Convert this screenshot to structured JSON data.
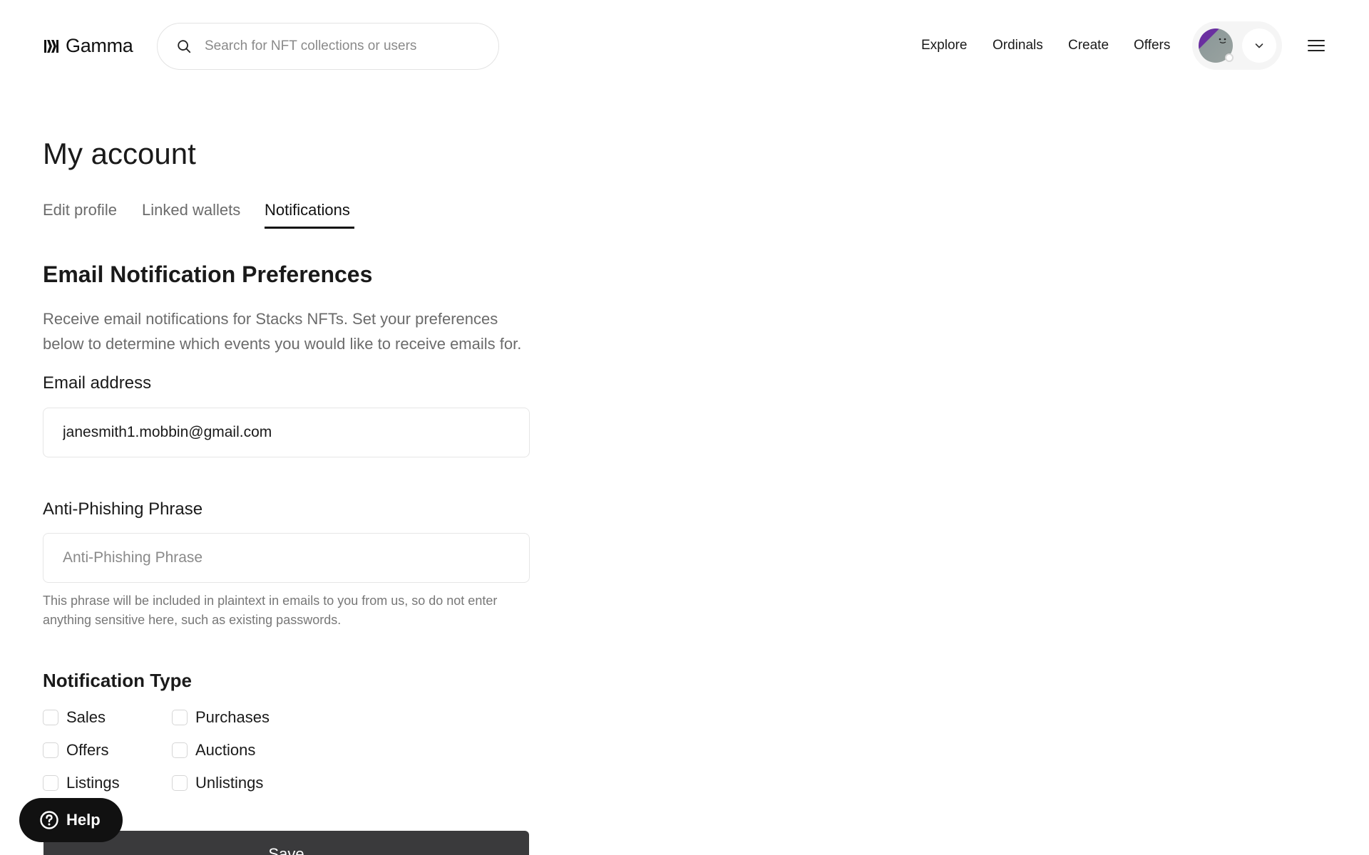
{
  "header": {
    "brand": "Gamma",
    "search": {
      "placeholder": "Search for NFT collections or users"
    },
    "nav": [
      {
        "label": "Explore"
      },
      {
        "label": "Ordinals"
      },
      {
        "label": "Create"
      },
      {
        "label": "Offers"
      }
    ],
    "icons": {
      "logo": "gamma-logo-icon",
      "search": "search-icon",
      "account_menu": "chevron-down-icon",
      "main_menu": "hamburger-menu-icon"
    }
  },
  "page": {
    "title": "My account",
    "tabs": [
      {
        "label": "Edit profile",
        "active": false
      },
      {
        "label": "Linked wallets",
        "active": false
      },
      {
        "label": "Notifications",
        "active": true
      }
    ]
  },
  "notifications": {
    "section_title": "Email Notification Preferences",
    "description": "Receive email notifications for Stacks NFTs. Set your preferences below to determine which events you would like to receive emails for.",
    "email": {
      "label": "Email address",
      "value": "janesmith1.mobbin@gmail.com"
    },
    "anti_phishing": {
      "label": "Anti-Phishing Phrase",
      "placeholder": "Anti-Phishing Phrase",
      "value": "",
      "helper": "This phrase will be included in plaintext in emails to you from us, so do not enter anything sensitive here, such as existing passwords."
    },
    "type_title": "Notification Type",
    "types": [
      {
        "label": "Sales",
        "checked": false
      },
      {
        "label": "Purchases",
        "checked": false
      },
      {
        "label": "Offers",
        "checked": false
      },
      {
        "label": "Auctions",
        "checked": false
      },
      {
        "label": "Listings",
        "checked": false
      },
      {
        "label": "Unlistings",
        "checked": false
      }
    ],
    "save_label": "Save"
  },
  "help": {
    "label": "Help",
    "icon": "question-circle-icon"
  },
  "colors": {
    "primary_button": "#3a3a3c",
    "help_button": "#111111",
    "muted_text": "#6b6b6b",
    "border": "#e6e6e6"
  }
}
